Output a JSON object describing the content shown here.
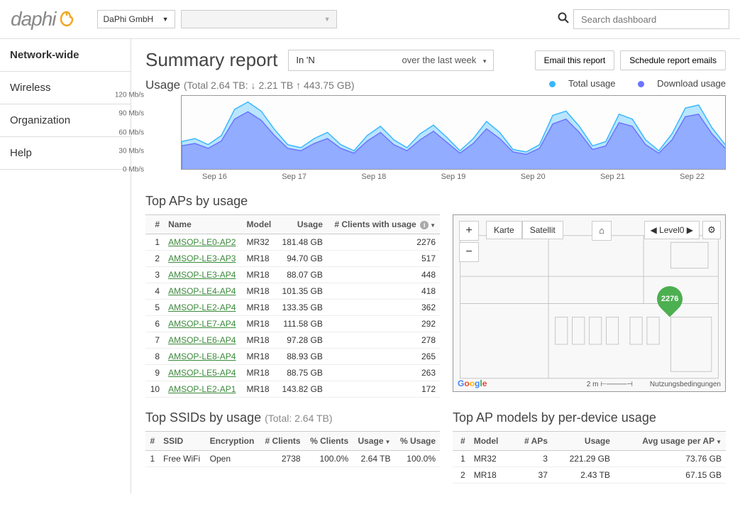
{
  "header": {
    "logo_text": "daphi",
    "org_dropdown": "DaPhi GmbH",
    "net_dropdown": "",
    "search_placeholder": "Search dashboard"
  },
  "sidebar": {
    "items": [
      "Network-wide",
      "Wireless",
      "Organization",
      "Help"
    ],
    "active_index": 0
  },
  "page": {
    "title": "Summary report",
    "filter_left": "In 'N",
    "filter_right": "over the last week",
    "btn_email": "Email this report",
    "btn_schedule": "Schedule report emails"
  },
  "usage": {
    "label": "Usage",
    "detail": "(Total 2.64 TB: ↓ 2.21 TB ↑ 443.75 GB)",
    "legend_total": "Total usage",
    "legend_down": "Download usage"
  },
  "chart_data": {
    "type": "area",
    "y_ticks": [
      "120 Mb/s",
      "90 Mb/s",
      "60 Mb/s",
      "30 Mb/s",
      "0 Mb/s"
    ],
    "x_ticks": [
      "Sep 16",
      "Sep 17",
      "Sep 18",
      "Sep 19",
      "Sep 20",
      "Sep 21",
      "Sep 22"
    ],
    "ylim": [
      0,
      120
    ],
    "series": [
      {
        "name": "Total usage",
        "color": "#38b6ff",
        "values": [
          45,
          50,
          40,
          55,
          98,
          110,
          95,
          65,
          40,
          35,
          50,
          60,
          40,
          30,
          55,
          70,
          48,
          35,
          58,
          72,
          52,
          30,
          50,
          78,
          60,
          32,
          28,
          40,
          88,
          95,
          70,
          38,
          45,
          90,
          82,
          48,
          30,
          58,
          100,
          105,
          68,
          40
        ]
      },
      {
        "name": "Download usage",
        "color": "#6b73ff",
        "values": [
          38,
          42,
          34,
          46,
          82,
          94,
          80,
          55,
          34,
          30,
          42,
          50,
          34,
          26,
          46,
          60,
          40,
          30,
          48,
          62,
          44,
          26,
          42,
          66,
          50,
          28,
          24,
          34,
          74,
          82,
          60,
          32,
          38,
          76,
          70,
          40,
          26,
          48,
          86,
          90,
          58,
          34
        ]
      }
    ]
  },
  "top_aps": {
    "title": "Top APs by usage",
    "cols": {
      "num": "#",
      "name": "Name",
      "model": "Model",
      "usage": "Usage",
      "clients": "# Clients with usage"
    },
    "rows": [
      {
        "n": "1",
        "name": "AMSOP-LE0-AP2",
        "model": "MR32",
        "usage": "181.48 GB",
        "clients": "2276"
      },
      {
        "n": "2",
        "name": "AMSOP-LE3-AP3",
        "model": "MR18",
        "usage": "94.70 GB",
        "clients": "517"
      },
      {
        "n": "3",
        "name": "AMSOP-LE3-AP4",
        "model": "MR18",
        "usage": "88.07 GB",
        "clients": "448"
      },
      {
        "n": "4",
        "name": "AMSOP-LE4-AP4",
        "model": "MR18",
        "usage": "101.35 GB",
        "clients": "418"
      },
      {
        "n": "5",
        "name": "AMSOP-LE2-AP4",
        "model": "MR18",
        "usage": "133.35 GB",
        "clients": "362"
      },
      {
        "n": "6",
        "name": "AMSOP-LE7-AP4",
        "model": "MR18",
        "usage": "111.58 GB",
        "clients": "292"
      },
      {
        "n": "7",
        "name": "AMSOP-LE6-AP4",
        "model": "MR18",
        "usage": "97.28 GB",
        "clients": "278"
      },
      {
        "n": "8",
        "name": "AMSOP-LE8-AP4",
        "model": "MR18",
        "usage": "88.93 GB",
        "clients": "265"
      },
      {
        "n": "9",
        "name": "AMSOP-LE5-AP4",
        "model": "MR18",
        "usage": "88.75 GB",
        "clients": "263"
      },
      {
        "n": "10",
        "name": "AMSOP-LE2-AP1",
        "model": "MR18",
        "usage": "143.82 GB",
        "clients": "172"
      }
    ]
  },
  "map": {
    "tab_map": "Karte",
    "tab_sat": "Satellit",
    "level": "Level0",
    "marker": "2276",
    "scale": "2 m",
    "terms": "Nutzungsbedingungen"
  },
  "top_ssids": {
    "title": "Top SSIDs by usage",
    "title_sub": "(Total: 2.64 TB)",
    "cols": {
      "num": "#",
      "ssid": "SSID",
      "enc": "Encryption",
      "nclients": "# Clients",
      "pclients": "% Clients",
      "usage": "Usage",
      "pusage": "% Usage"
    },
    "rows": [
      {
        "n": "1",
        "ssid": "Free WiFi",
        "enc": "Open",
        "nclients": "2738",
        "pclients": "100.0%",
        "usage": "2.64 TB",
        "pusage": "100.0%"
      }
    ]
  },
  "top_models": {
    "title": "Top AP models by per-device usage",
    "cols": {
      "num": "#",
      "model": "Model",
      "naps": "# APs",
      "usage": "Usage",
      "avg": "Avg usage per AP"
    },
    "rows": [
      {
        "n": "1",
        "model": "MR32",
        "naps": "3",
        "usage": "221.29 GB",
        "avg": "73.76 GB"
      },
      {
        "n": "2",
        "model": "MR18",
        "naps": "37",
        "usage": "2.43 TB",
        "avg": "67.15 GB"
      }
    ]
  }
}
